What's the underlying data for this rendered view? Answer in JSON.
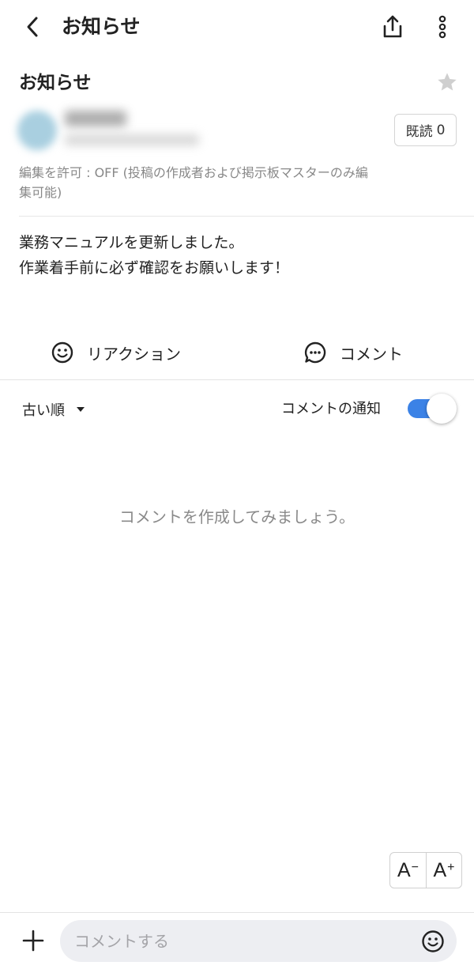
{
  "header": {
    "title": "お知らせ",
    "icons": [
      "back-arrow-icon",
      "share-icon",
      "more-vertical-icon"
    ]
  },
  "post": {
    "title": "お知らせ",
    "favorite_icon": "star-icon",
    "read_label": "既読",
    "read_count": "0",
    "edit_permission": "編集を許可 : OFF (投稿の作成者および掲示板マスターのみ編集可能)",
    "body_lines": [
      "業務マニュアルを更新しました。",
      "作業着手前に必ず確認をお願いします！"
    ]
  },
  "actions": {
    "reaction_label": "リアクション",
    "comment_label": "コメント"
  },
  "comments": {
    "sort_label": "古い順",
    "notify_label": "コメントの通知",
    "notify_enabled": true,
    "empty_message": "コメントを作成してみましょう。"
  },
  "font_size_controls": {
    "decrease_label": "A",
    "increase_label": "A"
  },
  "composer": {
    "placeholder": "コメントする",
    "add_icon": "plus-icon",
    "emoji_icon": "smiley-icon"
  },
  "colors": {
    "accent": "#3b82e6",
    "text": "#222222",
    "muted": "#888888",
    "input_bg": "#edeef2"
  }
}
